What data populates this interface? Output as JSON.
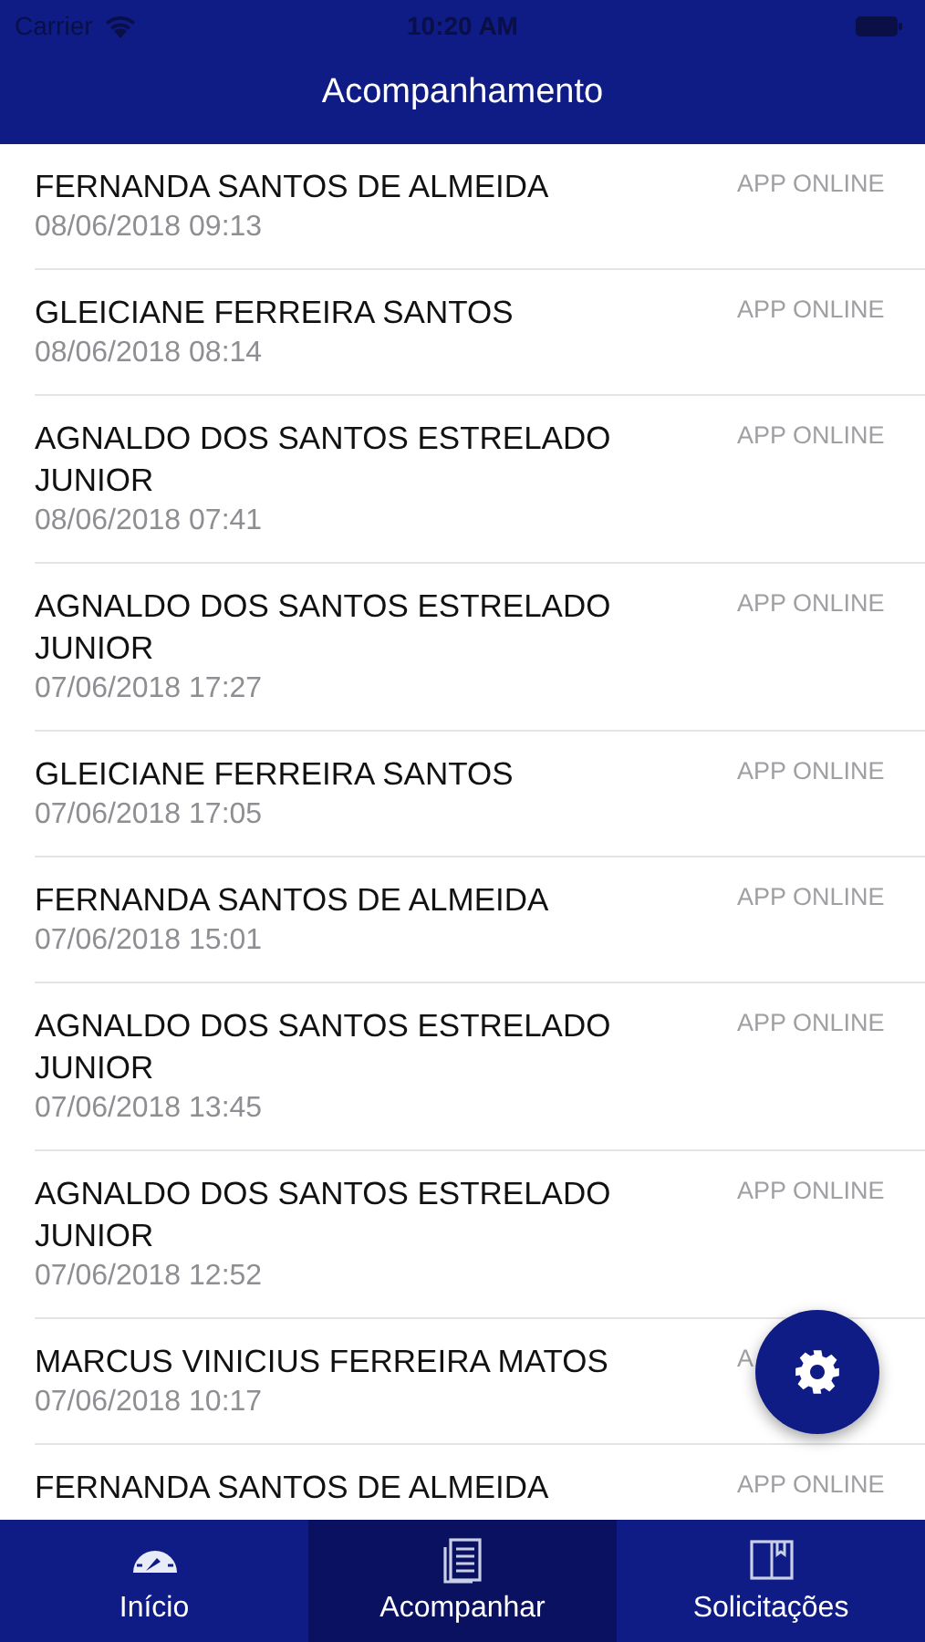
{
  "status_bar": {
    "carrier": "Carrier",
    "time": "10:20 AM"
  },
  "nav_bar": {
    "title": "Acompanhamento"
  },
  "list": [
    {
      "name": "FERNANDA SANTOS DE ALMEIDA",
      "date": "08/06/2018 09:13",
      "status": "APP ONLINE"
    },
    {
      "name": "GLEICIANE FERREIRA SANTOS",
      "date": "08/06/2018 08:14",
      "status": "APP ONLINE"
    },
    {
      "name": "AGNALDO DOS SANTOS ESTRELADO JUNIOR",
      "date": "08/06/2018 07:41",
      "status": "APP ONLINE"
    },
    {
      "name": "AGNALDO DOS SANTOS ESTRELADO JUNIOR",
      "date": "07/06/2018 17:27",
      "status": "APP ONLINE"
    },
    {
      "name": "GLEICIANE FERREIRA SANTOS",
      "date": "07/06/2018 17:05",
      "status": "APP ONLINE"
    },
    {
      "name": "FERNANDA SANTOS DE ALMEIDA",
      "date": "07/06/2018 15:01",
      "status": "APP ONLINE"
    },
    {
      "name": "AGNALDO DOS SANTOS ESTRELADO JUNIOR",
      "date": "07/06/2018 13:45",
      "status": "APP ONLINE"
    },
    {
      "name": "AGNALDO DOS SANTOS ESTRELADO JUNIOR",
      "date": "07/06/2018 12:52",
      "status": "APP ONLINE"
    },
    {
      "name": "MARCUS VINICIUS FERREIRA MATOS",
      "date": "07/06/2018 10:17",
      "status": "A"
    },
    {
      "name": "FERNANDA SANTOS DE ALMEIDA",
      "status": "APP ONLINE"
    }
  ],
  "tab_bar": [
    {
      "label": "Início",
      "kind": "gauge",
      "selected": false
    },
    {
      "label": "Acompanhar",
      "kind": "document",
      "selected": true
    },
    {
      "label": "Solicitações",
      "kind": "book",
      "selected": false
    }
  ]
}
